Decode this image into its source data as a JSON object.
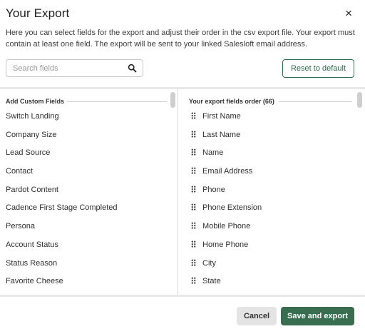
{
  "dialog": {
    "title": "Your Export",
    "close_label": "×",
    "description": "Here you can select fields for the export and adjust their order in the csv export file. Your export must contain at least one field. The export will be sent to your linked Salesloft email address."
  },
  "search": {
    "placeholder": "Search fields",
    "value": "",
    "icon": "search-icon"
  },
  "reset_button": {
    "label": "Reset to default"
  },
  "left_panel": {
    "header": "Add Custom Fields",
    "items": [
      "Switch Landing",
      "Company Size",
      "Lead Source",
      "Contact",
      "Pardot Content",
      "Cadence First Stage Completed",
      "Persona",
      "Account Status",
      "Status Reason",
      "Favorite Cheese"
    ]
  },
  "right_panel": {
    "header": "Your export fields order (66)",
    "items": [
      "First Name",
      "Last Name",
      "Name",
      "Email Address",
      "Phone",
      "Phone Extension",
      "Mobile Phone",
      "Home Phone",
      "City",
      "State"
    ]
  },
  "footer": {
    "cancel_label": "Cancel",
    "save_label": "Save and export"
  },
  "colors": {
    "accent": "#386d50",
    "accent_border": "#2e6b4f",
    "cancel_bg": "#e4e4e4"
  }
}
